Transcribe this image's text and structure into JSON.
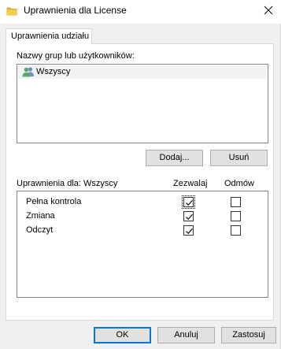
{
  "window": {
    "title": "Uprawnienia dla License"
  },
  "tabs": [
    {
      "label": "Uprawnienia udziału",
      "active": true
    }
  ],
  "groups": {
    "label": "Nazwy grup lub użytkowników:",
    "items": [
      {
        "name": "Wszyscy",
        "icon": "users-icon",
        "selected": true
      }
    ]
  },
  "buttons": {
    "add": "Dodaj...",
    "remove": "Usuń",
    "ok": "OK",
    "cancel": "Anuluj",
    "apply": "Zastosuj"
  },
  "permissions": {
    "header": "Uprawnienia dla: Wszyscy",
    "allow_header": "Zezwalaj",
    "deny_header": "Odmów",
    "rows": [
      {
        "name": "Pełna kontrola",
        "allow": true,
        "deny": false
      },
      {
        "name": "Zmiana",
        "allow": true,
        "deny": false
      },
      {
        "name": "Odczyt",
        "allow": true,
        "deny": false
      }
    ]
  },
  "colors": {
    "folder_icon": "#e8b923",
    "accent_border": "#0078d7",
    "checkmark": "#222222"
  }
}
